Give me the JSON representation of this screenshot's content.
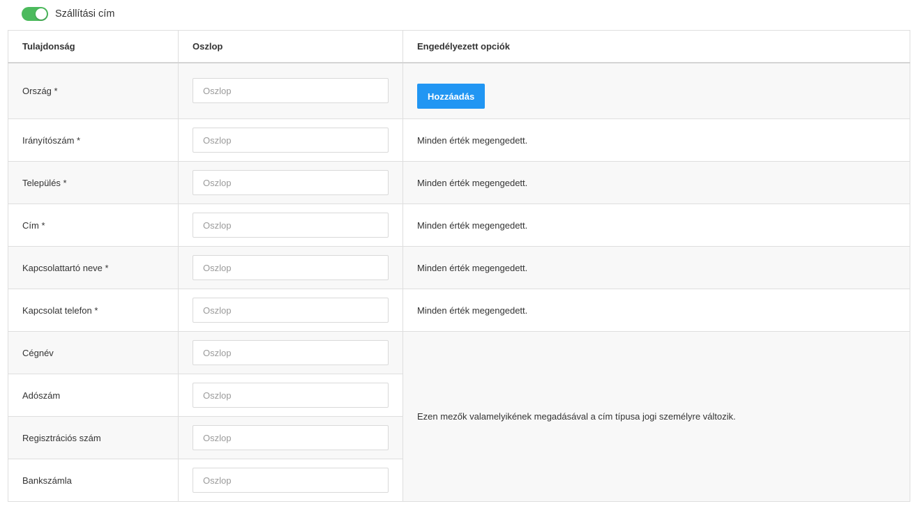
{
  "toggle": {
    "label": "Szállítási cím",
    "on": true,
    "color": "#4cba5d"
  },
  "table": {
    "headers": {
      "property": "Tulajdonság",
      "column": "Oszlop",
      "options": "Engedélyezett opciók"
    },
    "rows": [
      {
        "label": "Ország *",
        "placeholder": "Oszlop",
        "value": ""
      },
      {
        "label": "Irányítószám *",
        "placeholder": "Oszlop",
        "value": ""
      },
      {
        "label": "Település *",
        "placeholder": "Oszlop",
        "value": ""
      },
      {
        "label": "Cím *",
        "placeholder": "Oszlop",
        "value": ""
      },
      {
        "label": "Kapcsolattartó neve *",
        "placeholder": "Oszlop",
        "value": ""
      },
      {
        "label": "Kapcsolat telefon *",
        "placeholder": "Oszlop",
        "value": ""
      },
      {
        "label": "Cégnév",
        "placeholder": "Oszlop",
        "value": ""
      },
      {
        "label": "Adószám",
        "placeholder": "Oszlop",
        "value": ""
      },
      {
        "label": "Regisztrációs szám",
        "placeholder": "Oszlop",
        "value": ""
      },
      {
        "label": "Bankszámla",
        "placeholder": "Oszlop",
        "value": ""
      }
    ],
    "options": {
      "add_button": "Hozzáadás",
      "all_allowed": "Minden érték megengedett.",
      "company_note": "Ezen mezők valamelyikének megadásával a cím típusa jogi személyre változik."
    },
    "accent_color": "#2196f3"
  }
}
